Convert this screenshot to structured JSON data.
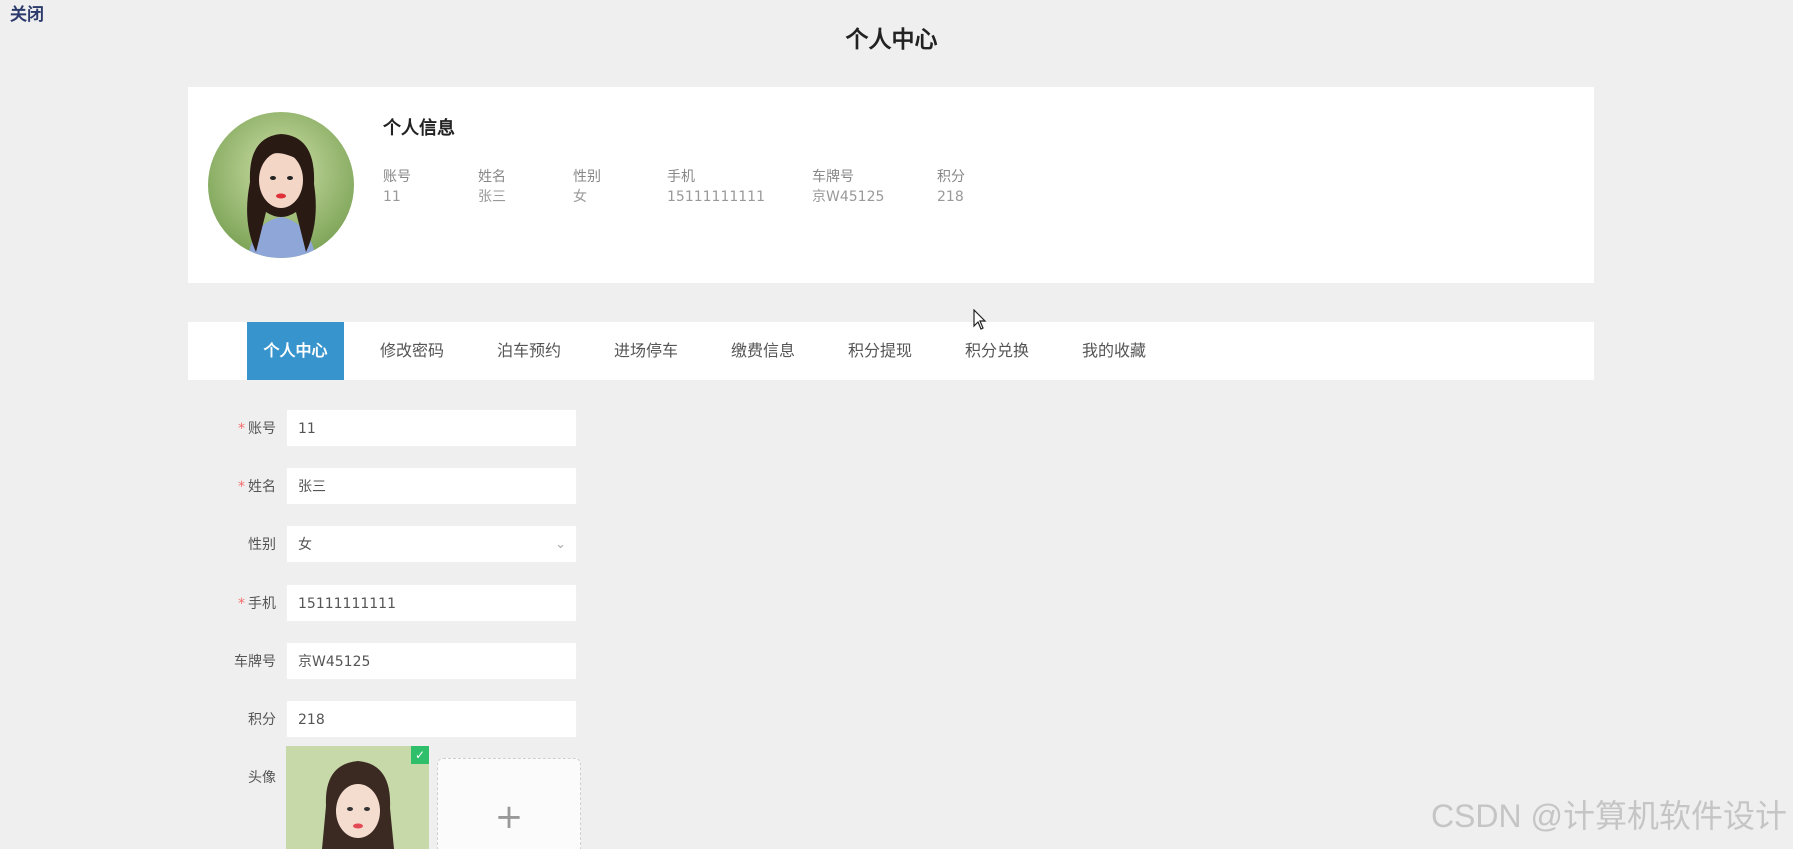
{
  "close_link": "关闭",
  "page_title": "个人中心",
  "profile": {
    "avatar_alt": "头像",
    "section_title": "个人信息",
    "fields": [
      {
        "label": "账号",
        "value": "11"
      },
      {
        "label": "姓名",
        "value": "张三"
      },
      {
        "label": "性别",
        "value": "女"
      },
      {
        "label": "手机",
        "value": "15111111111"
      },
      {
        "label": "车牌号",
        "value": "京W45125"
      },
      {
        "label": "积分",
        "value": "218"
      }
    ]
  },
  "tabs": [
    {
      "label": "个人中心",
      "active": true
    },
    {
      "label": "修改密码"
    },
    {
      "label": "泊车预约"
    },
    {
      "label": "进场停车"
    },
    {
      "label": "缴费信息"
    },
    {
      "label": "积分提现"
    },
    {
      "label": "积分兑换"
    },
    {
      "label": "我的收藏"
    }
  ],
  "form": {
    "required_mark": "*",
    "account": {
      "label": "账号",
      "value": "11"
    },
    "name": {
      "label": "姓名",
      "value": "张三"
    },
    "gender": {
      "label": "性别",
      "value": "女"
    },
    "phone": {
      "label": "手机",
      "value": "15111111111"
    },
    "plate": {
      "label": "车牌号",
      "value": "京W45125"
    },
    "points": {
      "label": "积分",
      "value": "218"
    },
    "avatar": {
      "label": "头像"
    },
    "upload_plus": "+",
    "chevron": "⌄",
    "check": "✓"
  },
  "watermark": "CSDN @计算机软件设计",
  "colors": {
    "accent": "#3894cc",
    "page_bg": "#efefef",
    "card_bg": "#ffffff",
    "required": "#f56c6c"
  }
}
